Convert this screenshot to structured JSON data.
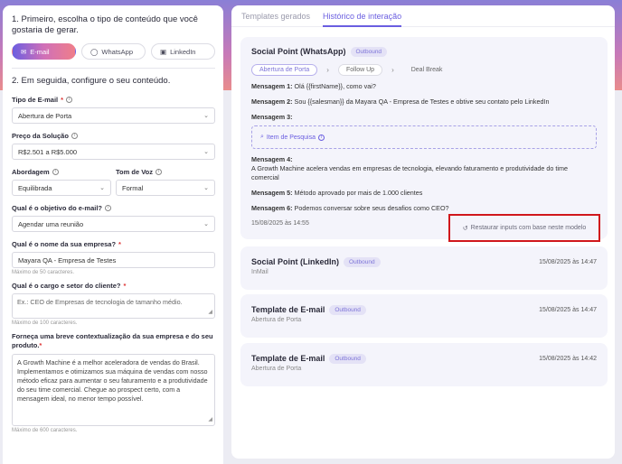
{
  "left": {
    "step1_heading": "1. Primeiro, escolha o tipo de conteúdo que você gostaria de gerar.",
    "types": [
      {
        "label": "E-mail",
        "icon": "mail-icon"
      },
      {
        "label": "WhatsApp",
        "icon": "whatsapp-icon"
      },
      {
        "label": "LinkedIn",
        "icon": "linkedin-icon"
      }
    ],
    "step2_heading": "2. Em seguida, configure o seu conteúdo.",
    "email_type": {
      "label": "Tipo de E-mail",
      "value": "Abertura de Porta"
    },
    "price": {
      "label": "Preço da Solução",
      "value": "R$2.501 a R$5.000"
    },
    "approach": {
      "label": "Abordagem",
      "value": "Equilibrada"
    },
    "tone": {
      "label": "Tom de Voz",
      "value": "Formal"
    },
    "objective": {
      "label": "Qual é o objetivo do e-mail?",
      "value": "Agendar uma reunião"
    },
    "company": {
      "label": "Qual é o nome da sua empresa?",
      "value": "Mayara QA - Empresa de Testes",
      "hint": "Máximo de 50 caracteres."
    },
    "client": {
      "label": "Qual é o cargo e setor do cliente?",
      "placeholder": "Ex.: CEO de Empresas de tecnologia de tamanho médio.",
      "hint": "Máximo de 100 caracteres."
    },
    "context": {
      "label": "Forneça uma breve contextualização da sua empresa e do seu produto.",
      "value": "A Growth Machine é a melhor aceleradora de vendas do Brasil. Implementamos e otimizamos sua máquina de vendas com nosso método eficaz para aumentar o seu faturamento e a produtividade do seu time comercial. Chegue ao prospect certo, com a mensagem ideal, no menor tempo possível.",
      "hint": "Máximo de 600 caracteres."
    }
  },
  "right": {
    "tabs": [
      "Templates gerados",
      "Histórico de interação"
    ],
    "main_card": {
      "title": "Social Point (WhatsApp)",
      "badge": "Outbound",
      "steps": [
        "Abertura de Porta",
        "Follow Up",
        "Deal Break"
      ],
      "messages": [
        {
          "label": "Mensagem 1:",
          "text": "Olá {{firstName}}, como vai?"
        },
        {
          "label": "Mensagem 2:",
          "text": "Sou {{salesman}} da Mayara QA - Empresa de Testes e obtive seu contato pelo LinkedIn"
        },
        {
          "label": "Mensagem 3:",
          "text": ""
        },
        {
          "label": "Mensagem 4:",
          "text": "A Growth Machine acelera vendas em empresas de tecnologia, elevando faturamento e produtividade do time comercial"
        },
        {
          "label": "Mensagem 5:",
          "text": "Método aprovado por mais de 1.000 clientes"
        },
        {
          "label": "Mensagem 6:",
          "text": "Podemos conversar sobre seus desafios como CEO?"
        }
      ],
      "research_item": "Item de Pesquisa",
      "date": "15/08/2025 às 14:55",
      "restore_label": "Restaurar inputs com base neste modelo"
    },
    "cards": [
      {
        "title": "Social Point (LinkedIn)",
        "badge": "Outbound",
        "sub": "InMail",
        "date": "15/08/2025 às 14:47"
      },
      {
        "title": "Template de E-mail",
        "badge": "Outbound",
        "sub": "Abertura de Porta",
        "date": "15/08/2025 às 14:47"
      },
      {
        "title": "Template de E-mail",
        "badge": "Outbound",
        "sub": "Abertura de Porta",
        "date": "15/08/2025 às 14:42"
      }
    ]
  }
}
